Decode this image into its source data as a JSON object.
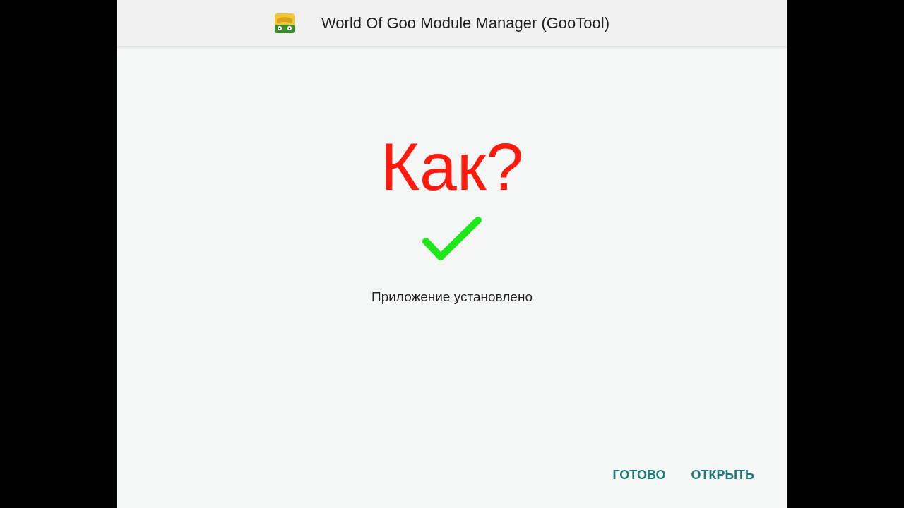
{
  "app_bar": {
    "title": "World Of Goo Module Manager (GooTool)"
  },
  "overlay_caption": "Как?",
  "result": {
    "message": "Приложение установлено"
  },
  "buttons": [
    {
      "label": "ГОТОВО"
    },
    {
      "label": "ОТКРЫТЬ"
    }
  ]
}
